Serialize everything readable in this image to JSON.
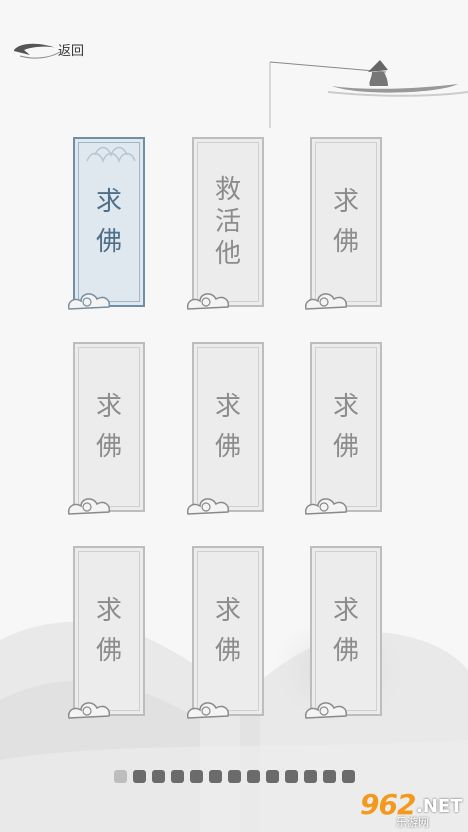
{
  "header": {
    "back_label": "返回"
  },
  "cards": [
    {
      "lines": [
        "求",
        "佛"
      ],
      "selected": true
    },
    {
      "lines": [
        "救",
        "活",
        "他"
      ],
      "selected": false
    },
    {
      "lines": [
        "求",
        "佛"
      ],
      "selected": false
    },
    {
      "lines": [
        "求",
        "佛"
      ],
      "selected": false
    },
    {
      "lines": [
        "求",
        "佛"
      ],
      "selected": false
    },
    {
      "lines": [
        "求",
        "佛"
      ],
      "selected": false
    },
    {
      "lines": [
        "求",
        "佛"
      ],
      "selected": false
    },
    {
      "lines": [
        "求",
        "佛"
      ],
      "selected": false
    },
    {
      "lines": [
        "求",
        "佛"
      ],
      "selected": false
    }
  ],
  "pager": {
    "total": 13,
    "current": 1
  },
  "watermark": {
    "number": "962",
    "suffix": ".NET",
    "sub": "乐游网"
  },
  "colors": {
    "selected_border": "#6f8fa6",
    "card_border": "#bdbdbd",
    "page_dot": "#6b6b6b",
    "watermark_orange": "#f39a1e"
  }
}
